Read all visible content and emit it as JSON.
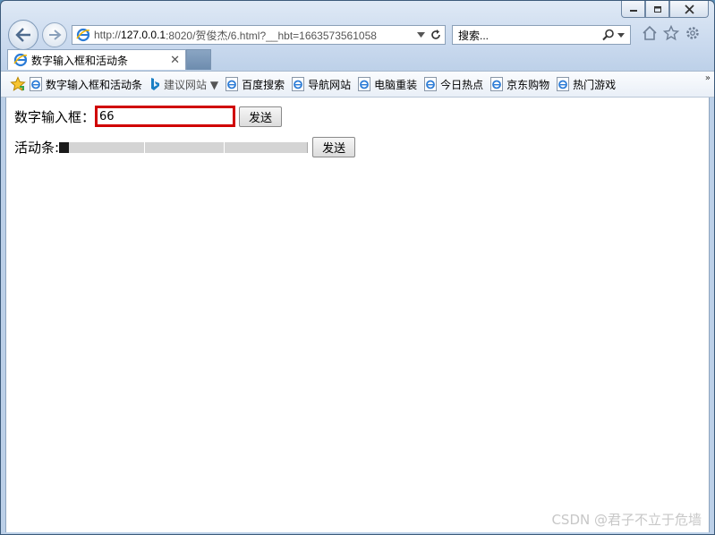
{
  "window": {
    "colors": {
      "accent": "#d00000",
      "chrome": "#c9d9ee",
      "thumb": "#1a1a1a",
      "track": "#d4d4d4"
    }
  },
  "address_bar": {
    "url_prefix": "http://",
    "url_host": "127.0.0.1",
    "url_rest": ":8020/贺俊杰/6.html?__hbt=1663573561058"
  },
  "search_bar": {
    "placeholder": "搜索..."
  },
  "tab": {
    "title": "数字输入框和活动条",
    "icon": "ie-icon"
  },
  "favorites": {
    "items": [
      {
        "label": "数字输入框和活动条",
        "icon": "ie-page-icon"
      },
      {
        "label": "建议网站 ▼",
        "icon": "bing-icon"
      },
      {
        "label": "百度搜索",
        "icon": "ie-page-icon"
      },
      {
        "label": "导航网站",
        "icon": "ie-page-icon"
      },
      {
        "label": "电脑重装",
        "icon": "ie-page-icon"
      },
      {
        "label": "今日热点",
        "icon": "ie-page-icon"
      },
      {
        "label": "京东购物",
        "icon": "ie-page-icon"
      },
      {
        "label": "热门游戏",
        "icon": "ie-page-icon"
      }
    ],
    "more": "»"
  },
  "form": {
    "number_label": "数字输入框：",
    "number_value": "66",
    "send_label": "发送",
    "range_label": "活动条:",
    "range_value_fraction": 0.0,
    "range_send_label": "发送"
  },
  "watermark": "CSDN @君子不立于危墙"
}
